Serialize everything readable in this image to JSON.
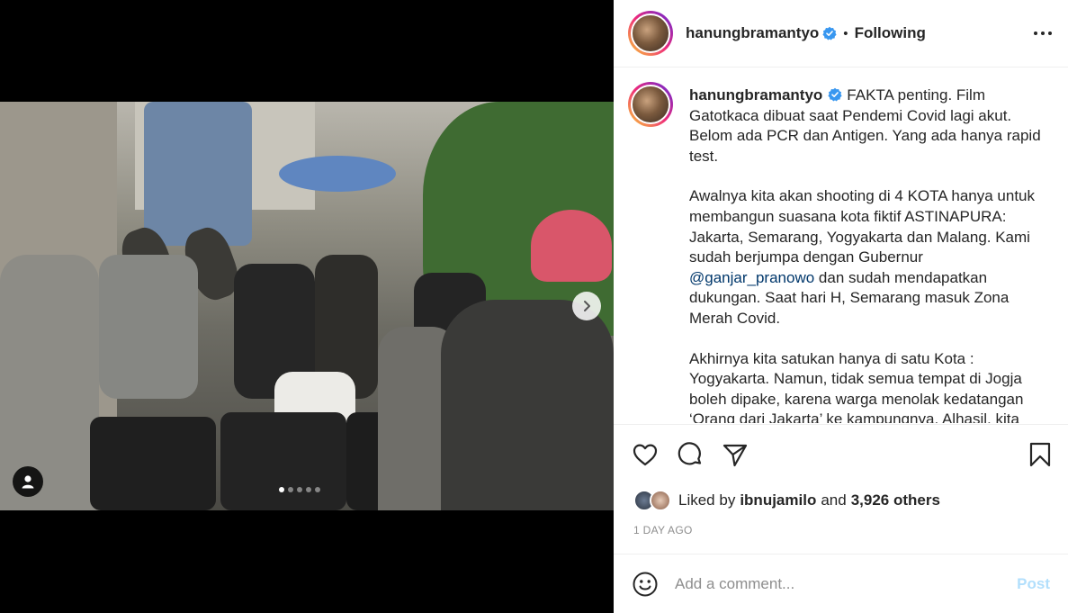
{
  "post": {
    "username": "hanungbramantyo",
    "separator": "•",
    "follow_state": "Following",
    "caption_paragraphs": [
      "FAKTA penting. Film Gatotkaca dibuat saat Pendemi Covid lagi akut. Belom ada PCR dan Antigen. Yang ada hanya rapid test.",
      "Awalnya kita akan shooting di 4 KOTA hanya untuk membangun suasana kota fiktif ASTINAPURA: Jakarta, Semarang, Yogyakarta dan Malang. Kami sudah berjumpa dengan Gubernur",
      "dan sudah mendapatkan dukungan. Saat hari H, Semarang masuk Zona Merah Covid.",
      "Akhirnya kita satukan hanya di satu Kota : Yogyakarta. Namun, tidak semua tempat di Jogja boleh dipake, karena warga menolak kedatangan ‘Orang dari Jakarta’ ke kampungnya. Alhasil, kita"
    ],
    "mention": "@ganjar_pranowo",
    "liked_by_prefix": "Liked by",
    "liked_by_user": "ibnujamilo",
    "liked_by_and": "and",
    "liked_by_others": "3,926 others",
    "timestamp": "1 DAY AGO",
    "comment_placeholder": "Add a comment...",
    "post_label": "Post",
    "carousel": {
      "total": 5,
      "active": 1
    }
  },
  "icons": {
    "verified": "verified-badge-icon",
    "more": "more-options-icon",
    "like": "heart-icon",
    "comment": "comment-icon",
    "share": "paper-plane-icon",
    "save": "bookmark-icon",
    "emoji": "emoji-icon",
    "next": "chevron-right-icon",
    "tags": "user-tag-icon"
  },
  "colors": {
    "verified": "#3897f0",
    "link": "#00376b",
    "post_disabled": "#b2dffc",
    "muted": "#8e8e8e"
  }
}
